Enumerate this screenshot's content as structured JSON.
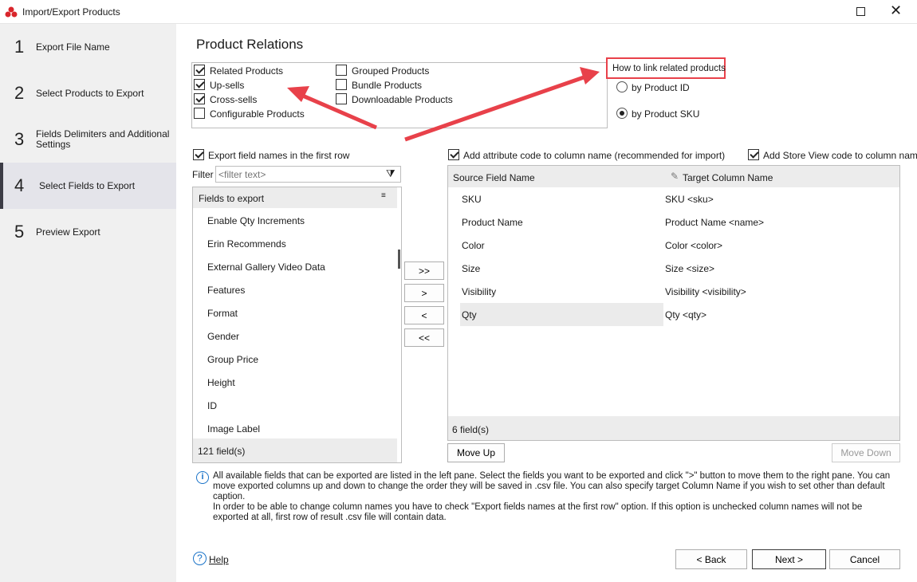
{
  "window": {
    "title": "Import/Export Products",
    "maximize_icon": "maximize-icon",
    "close_icon": "close-icon"
  },
  "sidebar": {
    "steps": [
      {
        "num": "1",
        "label": "Export File Name"
      },
      {
        "num": "2",
        "label": "Select Products to Export"
      },
      {
        "num": "3",
        "label": "Fields Delimiters and Additional Settings"
      },
      {
        "num": "4",
        "label": "Select Fields to Export",
        "active": true
      },
      {
        "num": "5",
        "label": "Preview Export"
      }
    ]
  },
  "relations": {
    "title": "Product Relations",
    "options": [
      {
        "label": "Related Products",
        "checked": true
      },
      {
        "label": "Up-sells",
        "checked": true
      },
      {
        "label": "Cross-sells",
        "checked": true
      },
      {
        "label": "Configurable Products",
        "checked": false
      },
      {
        "label": "Grouped Products",
        "checked": false
      },
      {
        "label": "Bundle Products",
        "checked": false
      },
      {
        "label": "Downloadable Products",
        "checked": false
      }
    ],
    "link_title": "How to link related products",
    "link_options": [
      {
        "label": "by Product ID",
        "selected": false
      },
      {
        "label": "by Product SKU",
        "selected": true
      }
    ]
  },
  "options": {
    "export_names": "Export field names in the  first row",
    "add_attr_code": "Add attribute code to column name (recommended for import)",
    "add_store_view": "Add Store View code to column nam"
  },
  "filter": {
    "label": "Filter",
    "placeholder": "<filter text>"
  },
  "left_list": {
    "header": "Fields to export",
    "items": [
      "Enable Qty Increments",
      "Erin Recommends",
      "External Gallery Video Data",
      "Features",
      "Format",
      "Gender",
      "Group Price",
      "Height",
      "ID",
      "Image Label"
    ],
    "count": "121 field(s)"
  },
  "move_buttons": [
    ">>",
    ">",
    "<",
    "<<"
  ],
  "right_table": {
    "col1": "Source Field Name",
    "col2": "Target Column Name",
    "rows": [
      {
        "source": "SKU",
        "target": "SKU <sku>"
      },
      {
        "source": "Product Name",
        "target": "Product Name <name>"
      },
      {
        "source": "Color",
        "target": "Color <color>"
      },
      {
        "source": "Size",
        "target": "Size <size>"
      },
      {
        "source": "Visibility",
        "target": "Visibility <visibility>"
      },
      {
        "source": "Qty",
        "target": "Qty <qty>"
      }
    ],
    "count": "6 field(s)"
  },
  "move_up": "Move Up",
  "move_down": "Move Down",
  "info": {
    "p1": "All available fields that can be exported are listed in the left pane. Select the fields you want to be exported and click \">\" button to move them to the right pane. You can move exported columns up and down to change the order they will be saved in .csv file. You can also specify target Column Name if you wish to set other than default caption.",
    "p2": "In order to be able to change column names you have to check \"Export fields names at the first row\" option. If this option is unchecked column names will not be exported at all, first row of result .csv file will contain data."
  },
  "footer": {
    "help": "Help",
    "back": "< Back",
    "next": "Next >",
    "cancel": "Cancel"
  },
  "colors": {
    "annotation": "#e8414a",
    "active_step": "#e4e4ea",
    "selected_row": "#ebebeb"
  }
}
